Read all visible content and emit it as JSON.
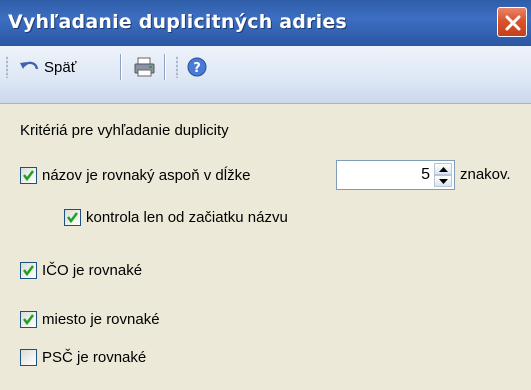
{
  "window": {
    "title": "Vyhľadanie duplicitných adries"
  },
  "toolbar": {
    "back_label": "Späť"
  },
  "criteria": {
    "heading": "Kritériá pre vyhľadanie duplicity",
    "name_equal": {
      "label": "názov je rovnaký aspoň v dĺžke",
      "checked": true
    },
    "name_length": {
      "value": "5",
      "unit": "znakov."
    },
    "check_start": {
      "label": "kontrola len od začiatku názvu",
      "checked": true
    },
    "ico_equal": {
      "label": "IČO je rovnaké",
      "checked": true
    },
    "city_equal": {
      "label": "miesto je rovnaké",
      "checked": true
    },
    "psc_equal": {
      "label": "PSČ je rovnaké",
      "checked": false
    }
  },
  "colors": {
    "titlebar": "#2f5ea8",
    "close": "#d9542e",
    "check": "#21a121",
    "background": "#ece9d8"
  }
}
